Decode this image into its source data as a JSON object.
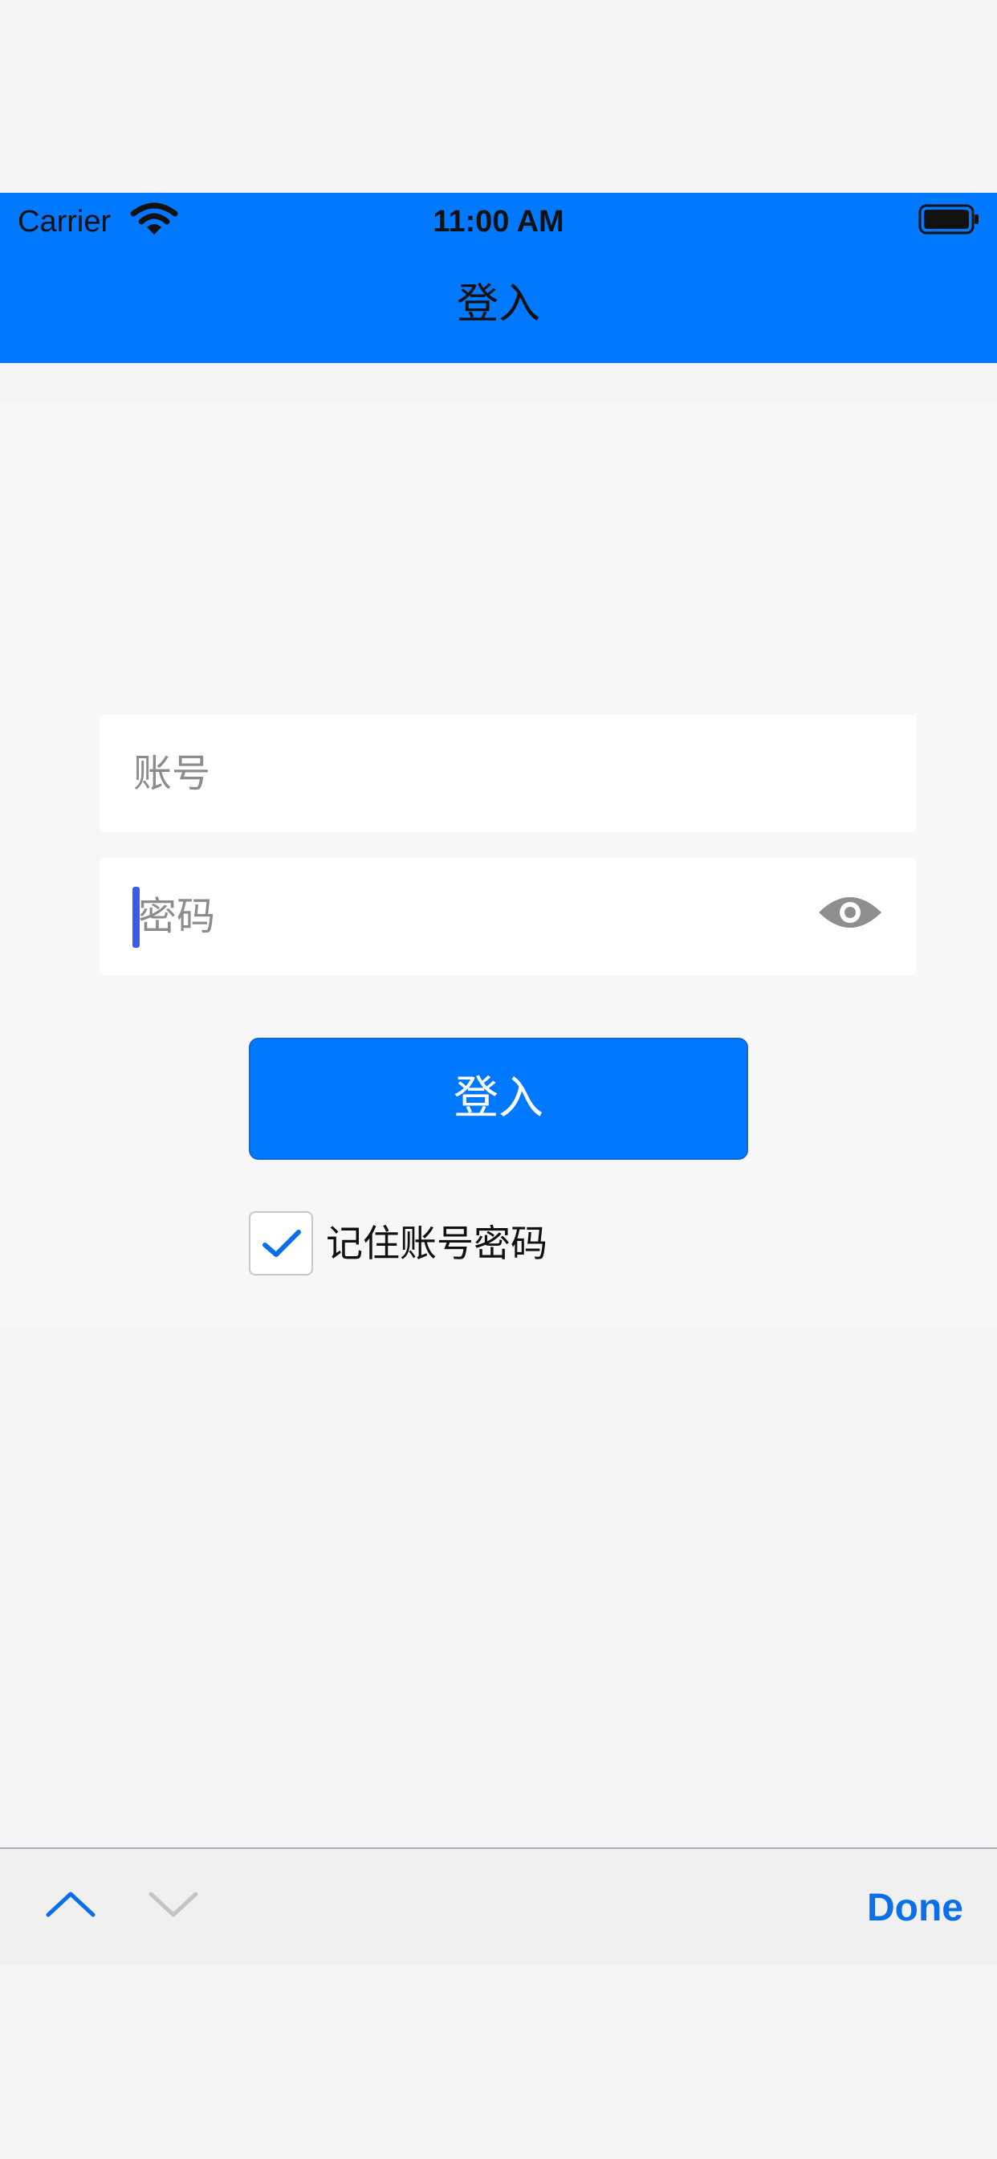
{
  "status_bar": {
    "carrier": "Carrier",
    "time": "11:00 AM",
    "wifi_icon": "wifi-icon",
    "battery_icon": "battery-full-icon"
  },
  "nav": {
    "title": "登入",
    "background_color": "#0079fe"
  },
  "login_form": {
    "username_placeholder": "账号",
    "username_value": "",
    "password_placeholder": "密码",
    "password_value": "",
    "password_visibility_icon": "eye-icon",
    "login_button_label": "登入",
    "remember_label": "记住账号密码",
    "remember_checked": true
  },
  "keyboard_toolbar": {
    "prev_icon": "chevron-up-icon",
    "next_icon": "chevron-down-icon",
    "done_label": "Done",
    "accent_color": "#0a6fe8"
  }
}
